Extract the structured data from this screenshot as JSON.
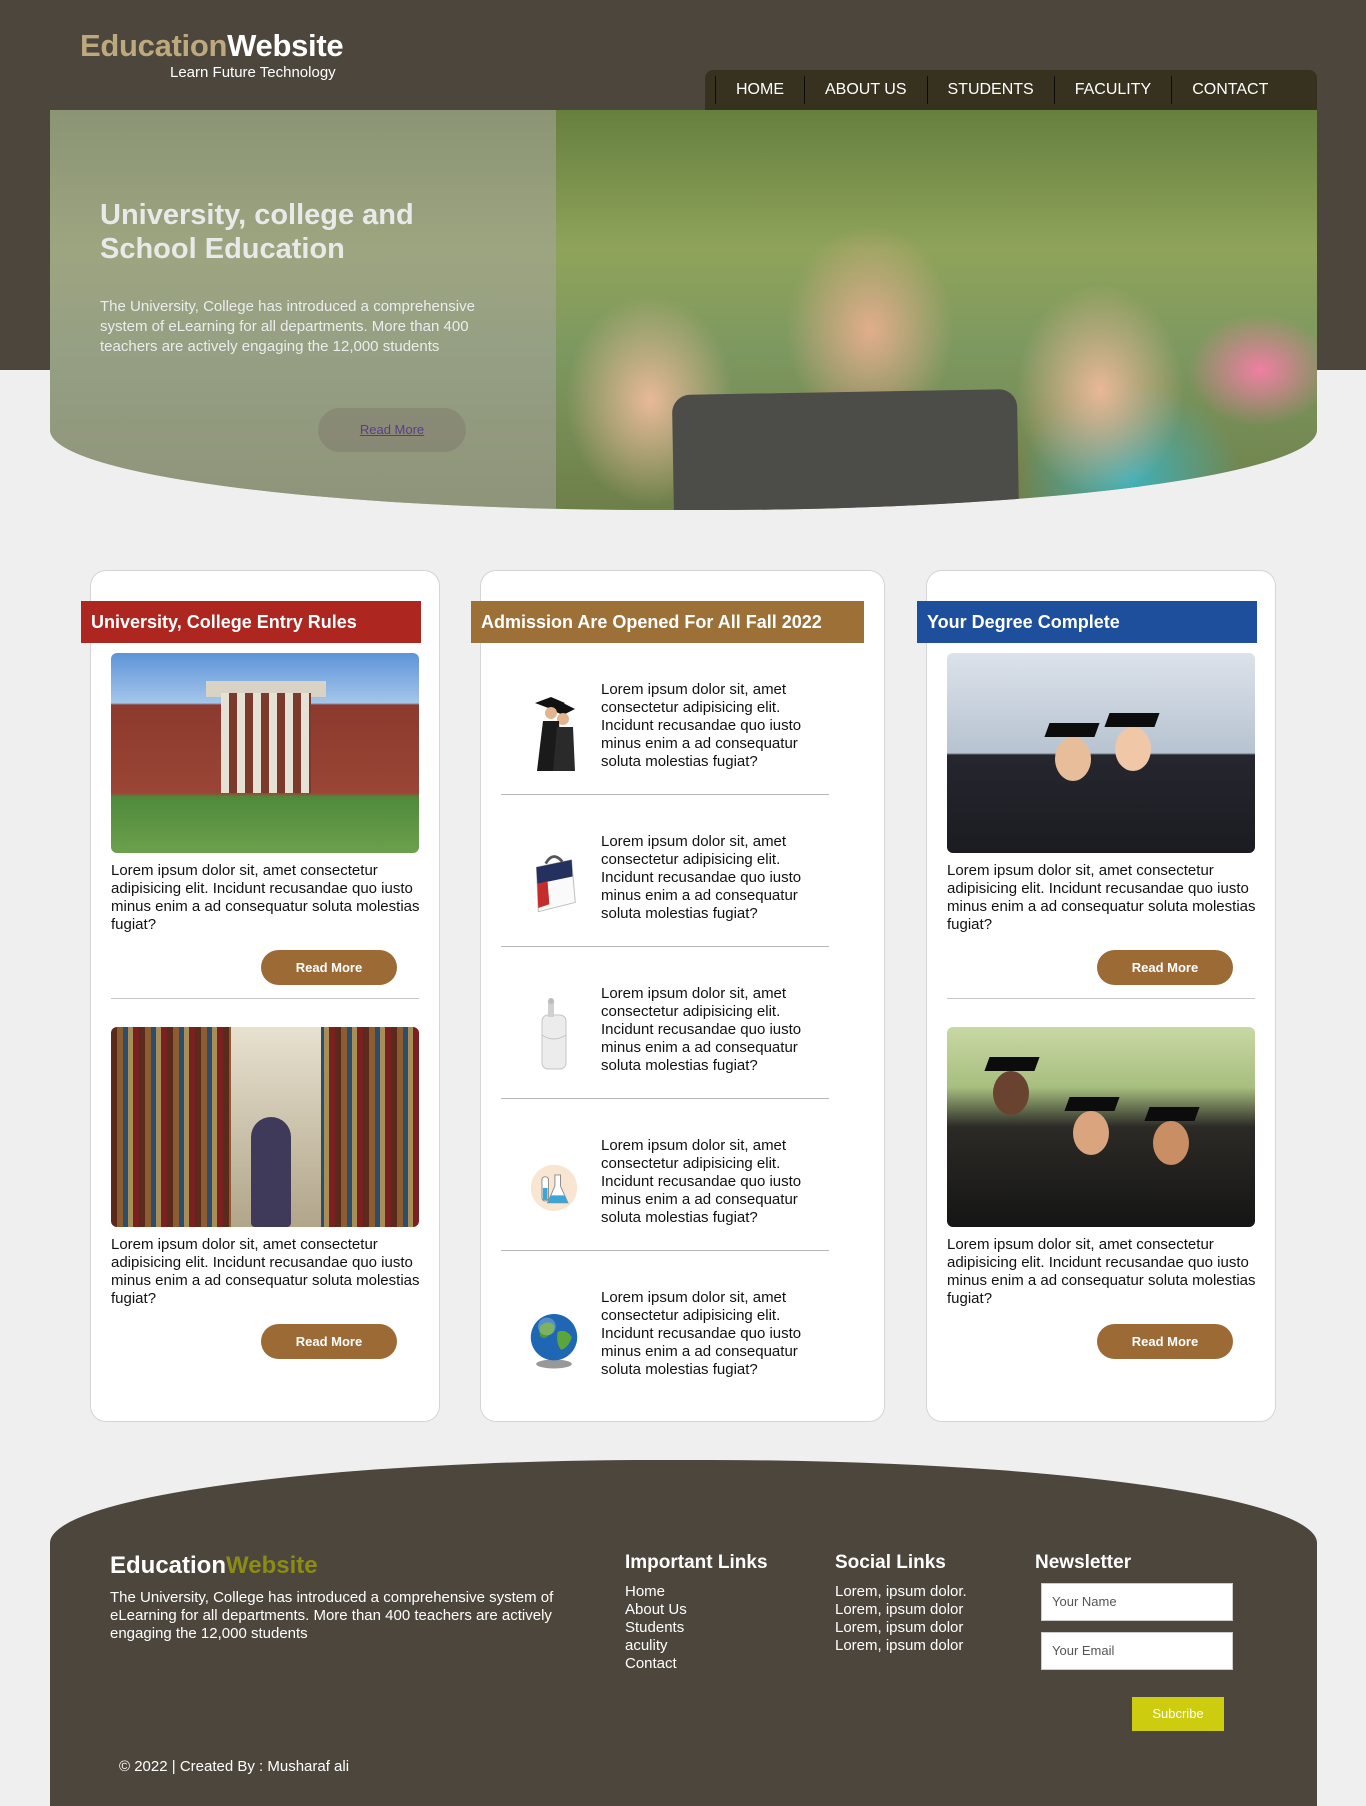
{
  "header": {
    "logo_part1": "Education",
    "logo_part2": "Website",
    "tagline": "Learn Future Technology"
  },
  "nav": [
    "HOME",
    "ABOUT US",
    "STUDENTS",
    "FACULITY",
    "CONTACT"
  ],
  "hero": {
    "title": "University, college and School Education",
    "text": "The University, College has introduced a comprehensive system of eLearning for all departments. More than 400 teachers are actively engaging the 12,000 students",
    "button": "Read More"
  },
  "card1": {
    "title": "University, College Entry Rules",
    "posts": [
      {
        "text": "Lorem ipsum dolor sit, amet consectetur adipisicing elit. Incidunt recusandae quo iusto minus enim a ad consequatur soluta molestias fugiat?",
        "button": "Read More"
      },
      {
        "text": "Lorem ipsum dolor sit, amet consectetur adipisicing elit. Incidunt recusandae quo iusto minus enim a ad consequatur soluta molestias fugiat?",
        "button": "Read More"
      }
    ]
  },
  "card2": {
    "title": "Admission Are Opened For All Fall 2022",
    "items": [
      {
        "icon": "graduates-icon",
        "text": "Lorem ipsum dolor sit, amet consectetur adipisicing elit. Incidunt recusandae quo iusto minus enim a ad consequatur soluta molestias fugiat?"
      },
      {
        "icon": "bag-icon",
        "text": "Lorem ipsum dolor sit, amet consectetur adipisicing elit. Incidunt recusandae quo iusto minus enim a ad consequatur soluta molestias fugiat?"
      },
      {
        "icon": "diploma-icon",
        "text": "Lorem ipsum dolor sit, amet consectetur adipisicing elit. Incidunt recusandae quo iusto minus enim a ad consequatur soluta molestias fugiat?"
      },
      {
        "icon": "lab-flask-icon",
        "text": "Lorem ipsum dolor sit, amet consectetur adipisicing elit. Incidunt recusandae quo iusto minus enim a ad consequatur soluta molestias fugiat?"
      },
      {
        "icon": "globe-icon",
        "text": "Lorem ipsum dolor sit, amet consectetur adipisicing elit. Incidunt recusandae quo iusto minus enim a ad consequatur soluta molestias fugiat?"
      }
    ]
  },
  "card3": {
    "title": "Your Degree Complete",
    "posts": [
      {
        "text": "Lorem ipsum dolor sit, amet consectetur adipisicing elit. Incidunt recusandae quo iusto minus enim a ad consequatur soluta molestias fugiat?",
        "button": "Read More"
      },
      {
        "text": "Lorem ipsum dolor sit, amet consectetur adipisicing elit. Incidunt recusandae quo iusto minus enim a ad consequatur soluta molestias fugiat?",
        "button": "Read More"
      }
    ]
  },
  "footer": {
    "logo_part1": "Education",
    "logo_part2": "Website",
    "about": "The University, College has introduced a comprehensive system of eLearning for all departments. More than 400 teachers are actively engaging the 12,000 students",
    "links_title": "Important Links",
    "links": [
      "Home",
      "About Us",
      "Students",
      "aculity",
      "Contact"
    ],
    "social_title": "Social Links",
    "social": [
      "Lorem, ipsum dolor.",
      "Lorem, ipsum dolor",
      "Lorem, ipsum dolor",
      "Lorem, ipsum dolor"
    ],
    "newsletter_title": "Newsletter",
    "name_placeholder": "Your Name",
    "email_placeholder": "Your Email",
    "subscribe": "Subcribe",
    "copyright": "© 2022 | Created By : Musharaf ali"
  },
  "colors": {
    "band": "#4d463c",
    "nav": "#37321f",
    "card1_ribbon": "#ad2720",
    "card2_ribbon": "#9c7037",
    "card3_ribbon": "#1e4f9c",
    "button": "#9c6b35",
    "subscribe": "#cdcc0e"
  }
}
